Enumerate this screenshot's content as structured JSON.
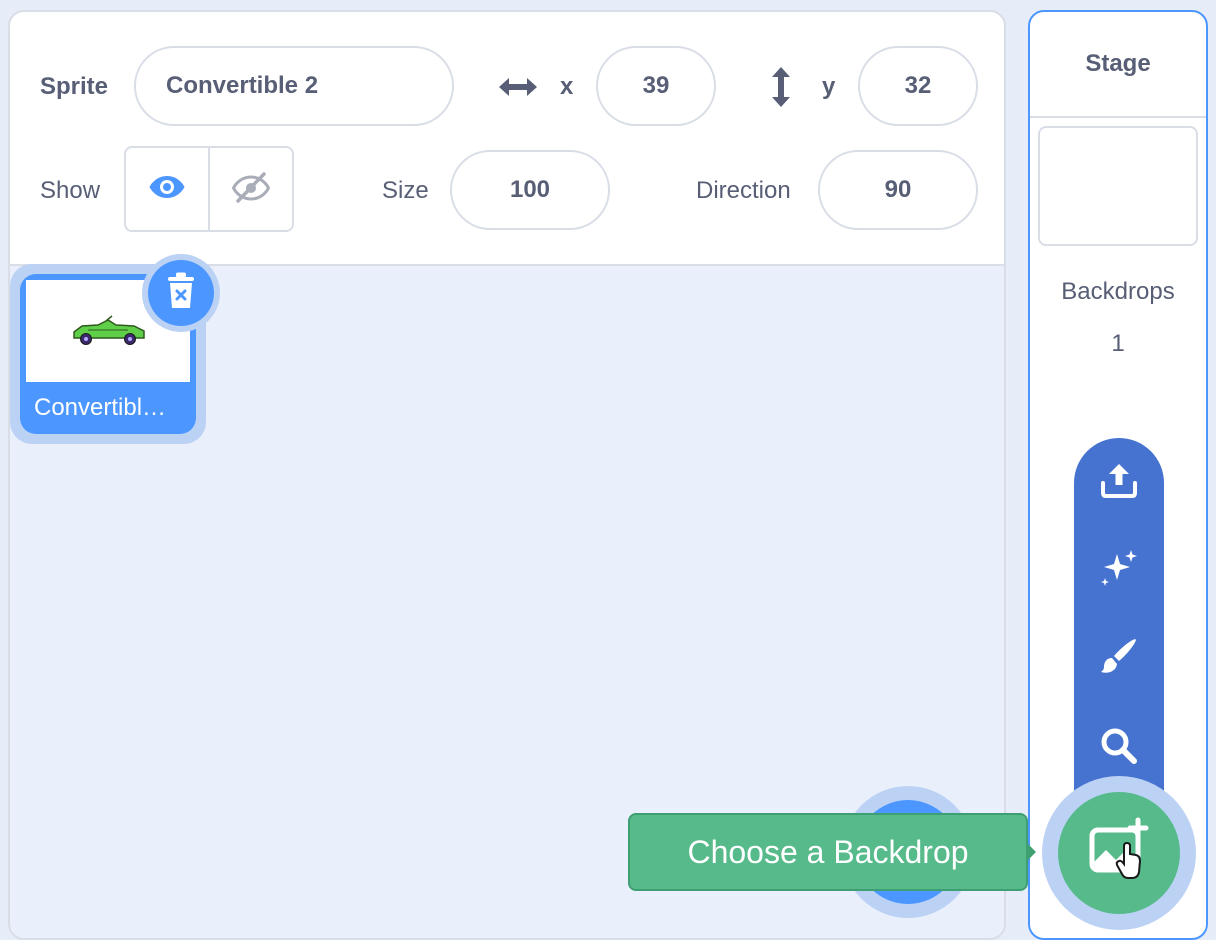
{
  "sprite_info": {
    "sprite_label": "Sprite",
    "sprite_name": "Convertible 2",
    "x_label": "x",
    "x_value": "39",
    "y_label": "y",
    "y_value": "32",
    "show_label": "Show",
    "size_label": "Size",
    "size_value": "100",
    "direction_label": "Direction",
    "direction_value": "90"
  },
  "sprites": [
    {
      "name": "Convertibl…",
      "selected": true
    }
  ],
  "stage": {
    "title": "Stage",
    "backdrops_label": "Backdrops",
    "backdrops_count": "1"
  },
  "backdrop_menu": {
    "items": [
      "upload-icon",
      "surprise-icon",
      "paint-icon",
      "search-icon"
    ],
    "main_icon": "choose-backdrop-icon",
    "tooltip": "Choose a Backdrop"
  },
  "colors": {
    "accent": "#4c97ff",
    "menu_blue": "#4673cf",
    "backdrop_green": "#56ba8b",
    "text": "#575e75",
    "border": "#d9dde6",
    "pane_bg": "#e9f0fc"
  }
}
